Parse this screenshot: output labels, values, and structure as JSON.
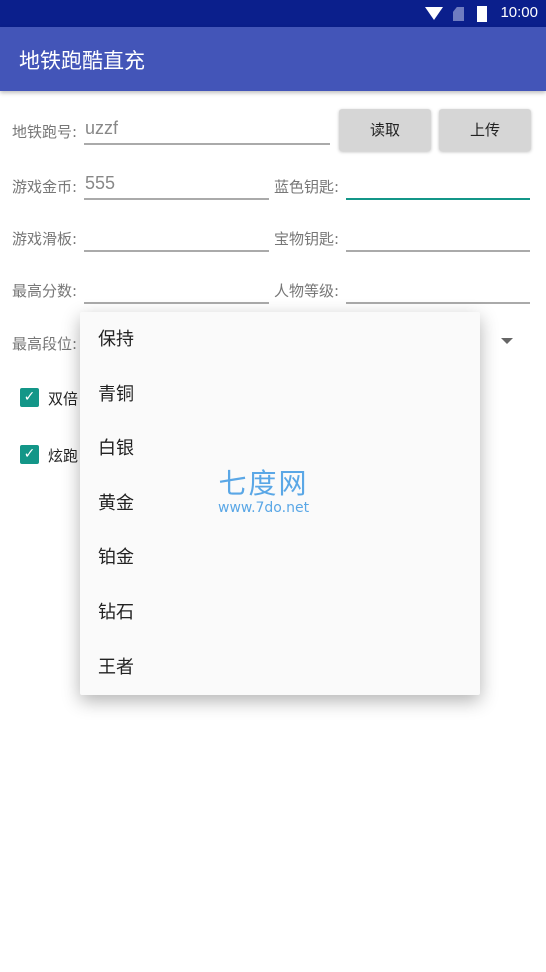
{
  "status_bar": {
    "time": "10:00",
    "icons": [
      "wifi-icon",
      "no-sim-icon",
      "battery-icon"
    ]
  },
  "app_bar": {
    "title": "地铁跑酷直充"
  },
  "form": {
    "account": {
      "label": "地铁跑号:",
      "value": "uzzf"
    },
    "read_button": "读取",
    "upload_button": "上传",
    "coins": {
      "label": "游戏金币:",
      "value": "555"
    },
    "blue_keys": {
      "label": "蓝色钥匙:",
      "value": ""
    },
    "skateboards": {
      "label": "游戏滑板:",
      "value": ""
    },
    "treasure_keys": {
      "label": "宝物钥匙:",
      "value": ""
    },
    "high_score": {
      "label": "最高分数:",
      "value": ""
    },
    "character_level": {
      "label": "人物等级:",
      "value": ""
    },
    "max_rank": {
      "label": "最高段位:"
    },
    "checkbox_double": {
      "label": "双倍",
      "checked": true
    },
    "checkbox_flash": {
      "label": "炫跑",
      "checked": true
    }
  },
  "dropdown": {
    "options": [
      "保持",
      "青铜",
      "白银",
      "黄金",
      "铂金",
      "钻石",
      "王者"
    ]
  },
  "watermark": {
    "title": "七度网",
    "url": "www.7do.net"
  },
  "colors": {
    "status_bar": "#0b1f8c",
    "app_bar": "#4355b8",
    "accent": "#139688"
  }
}
